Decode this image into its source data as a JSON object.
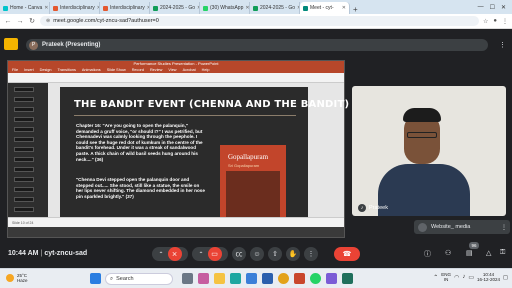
{
  "browser": {
    "tabs": [
      {
        "label": "Home - Canva",
        "color": "#00c4cc"
      },
      {
        "label": "Interdisciplinary",
        "color": "#e4572e"
      },
      {
        "label": "Interdisciplinary",
        "color": "#e4572e"
      },
      {
        "label": "2024-2025 - Go",
        "color": "#0f9d58"
      },
      {
        "label": "(30) WhatsApp",
        "color": "#25d366"
      },
      {
        "label": "2024-2025 - Go",
        "color": "#0f9d58"
      },
      {
        "label": "Meet - cyt-",
        "color": "#00897b"
      }
    ],
    "new_tab": "+",
    "url": "meet.google.com/cyt-zncu-sad?authuser=0"
  },
  "meet": {
    "presenter_initial": "P",
    "presenter_label": "Prateek (Presenting)",
    "participant_name": "Prateek",
    "presentation_tile_label": "Website_ media",
    "participant_count": "96",
    "clock": "10:44 AM",
    "divider": "|",
    "meeting_code": "cyt-zncu-sad"
  },
  "ppt": {
    "window_title": "Performance Studies Presentation - PowerPoint",
    "menu": [
      "File",
      "Insert",
      "Design",
      "Transitions",
      "Animations",
      "Slide Show",
      "Record",
      "Review",
      "View",
      "Acrobat",
      "Help"
    ],
    "status_text": "Slide 10 of 24",
    "slide": {
      "title": "THE BANDIT EVENT (CHENNA AND THE BANDIT)",
      "para1": "Chapter 16: \"Are you going to open the palanquin,\" demanded a gruff voice, \"or should I?\" I was petrified, but Chennadevi was calmly looking through the peephole. I could see the huge red dot of kumkum in the centre of the bandit's forehead. Under it was a streak of sandalwood paste. A thick chain of wild basil seeds hung around his neck....\" (36)",
      "para2": "\"Chenna Devi stepped open the palanquin door and stepped out..... She stood, still like a statue, the smile on her lips never shifting. The diamond embedded in her nose pin sparkled brightly.\" (37)",
      "book_title": "Gopallapuram",
      "book_subtitle": "Sri Gopallapuram"
    }
  },
  "taskbar": {
    "weather_temp": "25°C",
    "weather_desc": "Haze",
    "search_label": "Search",
    "lang": "ENG",
    "region": "IN",
    "time": "10:44",
    "date": "16-12-2024"
  }
}
